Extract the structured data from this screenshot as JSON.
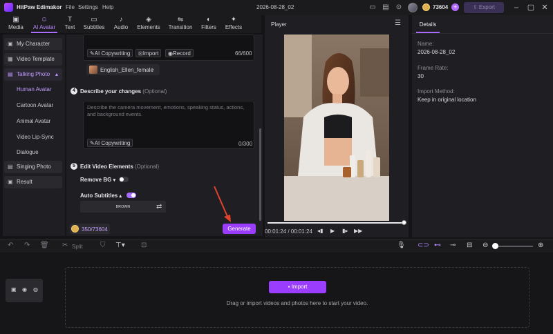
{
  "app": {
    "title": "HitPaw Edimakor",
    "menu": [
      "File",
      "Settings",
      "Help"
    ],
    "project_name": "2026-08-28_02",
    "coins": "73604",
    "export_label": "Export"
  },
  "toolbar": {
    "tabs": [
      {
        "label": "Media",
        "icon": "media-icon"
      },
      {
        "label": "AI Avatar",
        "icon": "ai-avatar-icon",
        "active": true
      },
      {
        "label": "Text",
        "icon": "text-icon"
      },
      {
        "label": "Subtitles",
        "icon": "subtitles-icon"
      },
      {
        "label": "Audio",
        "icon": "audio-icon"
      },
      {
        "label": "Elements",
        "icon": "elements-icon"
      },
      {
        "label": "Transition",
        "icon": "transition-icon"
      },
      {
        "label": "Filters",
        "icon": "filters-icon"
      },
      {
        "label": "Effects",
        "icon": "effects-icon"
      }
    ]
  },
  "sidebar": {
    "items": [
      {
        "label": "My Character",
        "icon": "character-icon"
      },
      {
        "label": "Video Template",
        "icon": "template-icon"
      },
      {
        "label": "Talking Photo",
        "icon": "photo-icon",
        "expanded": true
      },
      {
        "label": "Singing Photo",
        "icon": "photo-icon"
      },
      {
        "label": "Result",
        "icon": "result-icon"
      }
    ],
    "subitems": [
      "Human Avatar",
      "Cartoon Avatar",
      "Animal Avatar",
      "Video Lip-Sync",
      "Dialogue"
    ],
    "active_subitem": "Human Avatar"
  },
  "panel": {
    "ai_copywriting": "AI Copywriting",
    "import": "Import",
    "record": "Record",
    "script_count": "66/600",
    "voice": "English_Ellen_female",
    "step4": {
      "num": "4",
      "title": "Describe your changes",
      "optional": "(Optional)"
    },
    "desc_placeholder": "Describe the camera movement, emotions, speaking status, actions, and background events.",
    "desc_count": "0/300",
    "step5": {
      "num": "5",
      "title": "Edit Video Elements",
      "optional": "(Optional)"
    },
    "remove_bg": "Remove BG",
    "remove_bg_on": false,
    "auto_subtitles": "Auto Subtitles",
    "auto_subtitles_on": true,
    "subtitle_style_label": "BROWN",
    "credits": "350/73604",
    "generate": "Generate"
  },
  "player": {
    "title": "Player",
    "time": "00:01:24 / 00:01:24",
    "progress": 1.0
  },
  "details": {
    "tab": "Details",
    "fields": [
      {
        "label": "Name:",
        "value": "2026-08-28_02"
      },
      {
        "label": "Frame Rate:",
        "value": "30"
      },
      {
        "label": "Import Method:",
        "value": "Keep in original location"
      }
    ]
  },
  "timeline": {
    "split_label": "Split",
    "import_label": "Import",
    "hint": "Drag or import videos and photos here to start your video."
  },
  "colors": {
    "accent": "#a86bff",
    "button": "#9a3dfc",
    "background": "#141416"
  }
}
